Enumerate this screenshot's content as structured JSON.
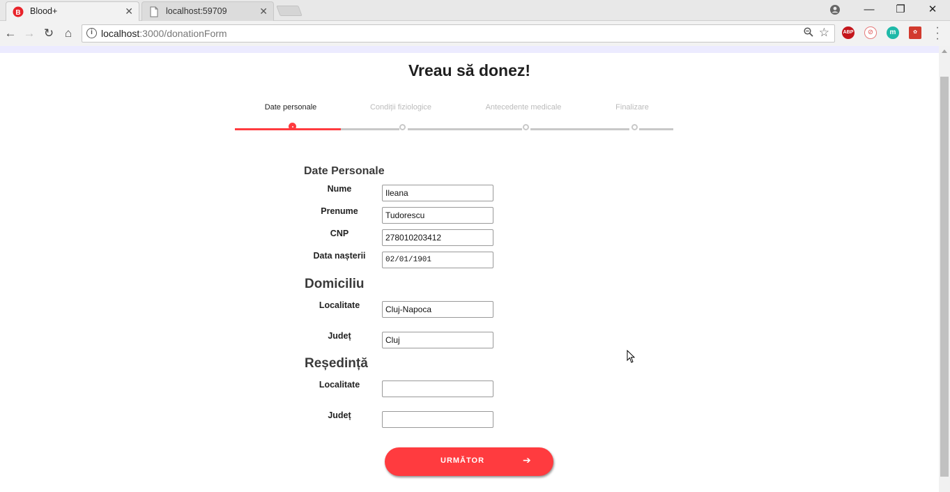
{
  "browser": {
    "tabs": [
      {
        "title": "Blood+",
        "active": true,
        "icon": "blood-plus-logo-icon"
      },
      {
        "title": "localhost:59709",
        "active": false,
        "icon": "document-icon"
      }
    ],
    "url_host": "localhost",
    "url_rest": ":3000/donationForm"
  },
  "page": {
    "title": "Vreau să donez!",
    "steps": [
      {
        "label": "Date personale",
        "active": true
      },
      {
        "label": "Condiții fiziologice",
        "active": false
      },
      {
        "label": "Antecedente medicale",
        "active": false
      },
      {
        "label": "Finalizare",
        "active": false
      }
    ],
    "personal": {
      "heading": "Date Personale",
      "nume_label": "Nume",
      "nume_value": "Ileana",
      "prenume_label": "Prenume",
      "prenume_value": "Tudorescu",
      "cnp_label": "CNP",
      "cnp_value": "278010203412",
      "birth_label": "Data nașterii",
      "birth_value": "02/01/1901"
    },
    "domiciliu": {
      "heading": "Domiciliu",
      "localitate_label": "Localitate",
      "localitate_value": "Cluj-Napoca",
      "judet_label": "Județ",
      "judet_value": "Cluj"
    },
    "resedinta": {
      "heading": "Reședință",
      "localitate_label": "Localitate",
      "localitate_value": "",
      "judet_label": "Județ",
      "judet_value": ""
    },
    "next_button": "URMĂTOR"
  },
  "colors": {
    "accent": "#ff3b3f",
    "inactive_step": "#c8c8c8"
  }
}
